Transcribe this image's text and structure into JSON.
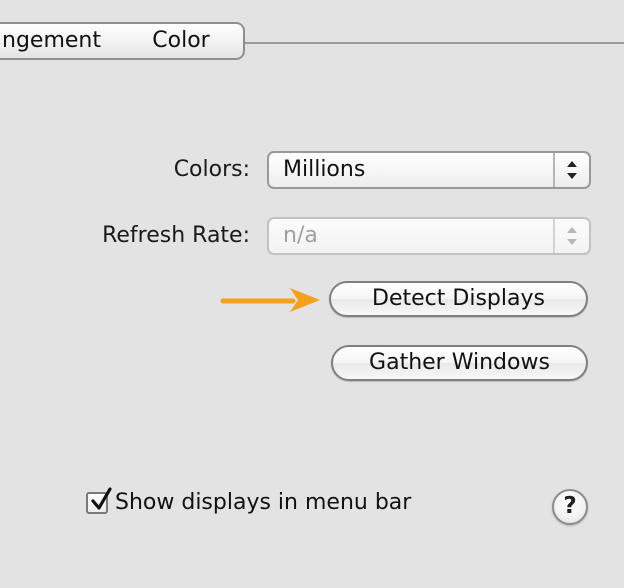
{
  "tabs": [
    {
      "label": "ngement"
    },
    {
      "label": "Color"
    }
  ],
  "display": {
    "colors": {
      "label": "Colors:",
      "value": "Millions"
    },
    "refresh_rate": {
      "label": "Refresh Rate:",
      "value": "n/a",
      "enabled": false
    },
    "detect_button": "Detect Displays",
    "gather_button": "Gather Windows",
    "show_menu_bar": {
      "label": "Show displays in menu bar",
      "checked": true
    },
    "help_label": "?"
  },
  "colors": {
    "background": "#e3e3e3",
    "annotation_arrow": "#f4a11d"
  },
  "icons": {
    "popup_stepper": "up-down-chevrons-icon",
    "annotation": "right-arrow-icon",
    "checkbox": "checkmark-icon",
    "help": "question-mark-icon"
  }
}
